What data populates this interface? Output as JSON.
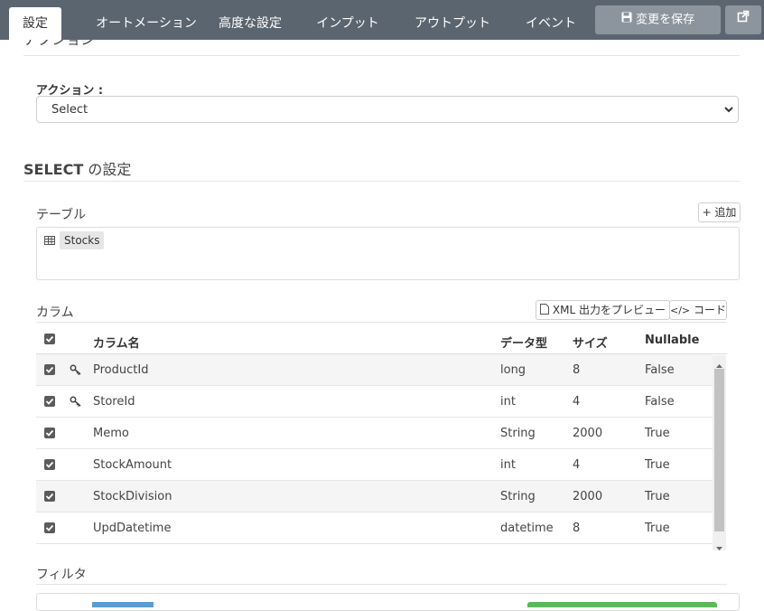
{
  "tabs": [
    {
      "label": "設定",
      "active": true
    },
    {
      "label": "オートメーション",
      "active": false
    },
    {
      "label": "高度な設定",
      "active": false
    },
    {
      "label": "インプット",
      "active": false
    },
    {
      "label": "アウトプット",
      "active": false
    },
    {
      "label": "イベント",
      "active": false
    }
  ],
  "header": {
    "save_label": "変更を保存",
    "external_icon": "external-link-icon",
    "save_icon": "floppy-disk-icon"
  },
  "action_section": {
    "partial_heading": "アクション",
    "action_label": "アクション :",
    "action_value": "Select"
  },
  "select_settings": {
    "title_bold": "SELECT",
    "title_rest": " の設定",
    "table_label": "テーブル",
    "add_button": "+ 追加",
    "tables": [
      {
        "name": "Stocks",
        "icon": "table-icon"
      }
    ]
  },
  "columns": {
    "label": "カラム",
    "preview_xml_button": "XML 出力をプレビュー",
    "code_button": "コード",
    "headers": {
      "name": "カラム名",
      "type": "データ型",
      "size": "サイズ",
      "nullable": "Nullable"
    },
    "rows": [
      {
        "checked": true,
        "key": true,
        "name": "ProductId",
        "type": "long",
        "size": "8",
        "nullable": "False"
      },
      {
        "checked": true,
        "key": true,
        "name": "StoreId",
        "type": "int",
        "size": "4",
        "nullable": "False"
      },
      {
        "checked": true,
        "key": false,
        "name": "Memo",
        "type": "String",
        "size": "2000",
        "nullable": "True"
      },
      {
        "checked": true,
        "key": false,
        "name": "StockAmount",
        "type": "int",
        "size": "4",
        "nullable": "True"
      },
      {
        "checked": true,
        "key": false,
        "name": "StockDivision",
        "type": "String",
        "size": "2000",
        "nullable": "True"
      },
      {
        "checked": true,
        "key": false,
        "name": "UpdDatetime",
        "type": "datetime",
        "size": "8",
        "nullable": "True"
      }
    ]
  },
  "filter": {
    "label": "フィルタ"
  },
  "colors": {
    "topbar": "#5b6570",
    "button": "#8c959e",
    "checkbox": "#5b5b5b",
    "green": "#5cb85c"
  }
}
